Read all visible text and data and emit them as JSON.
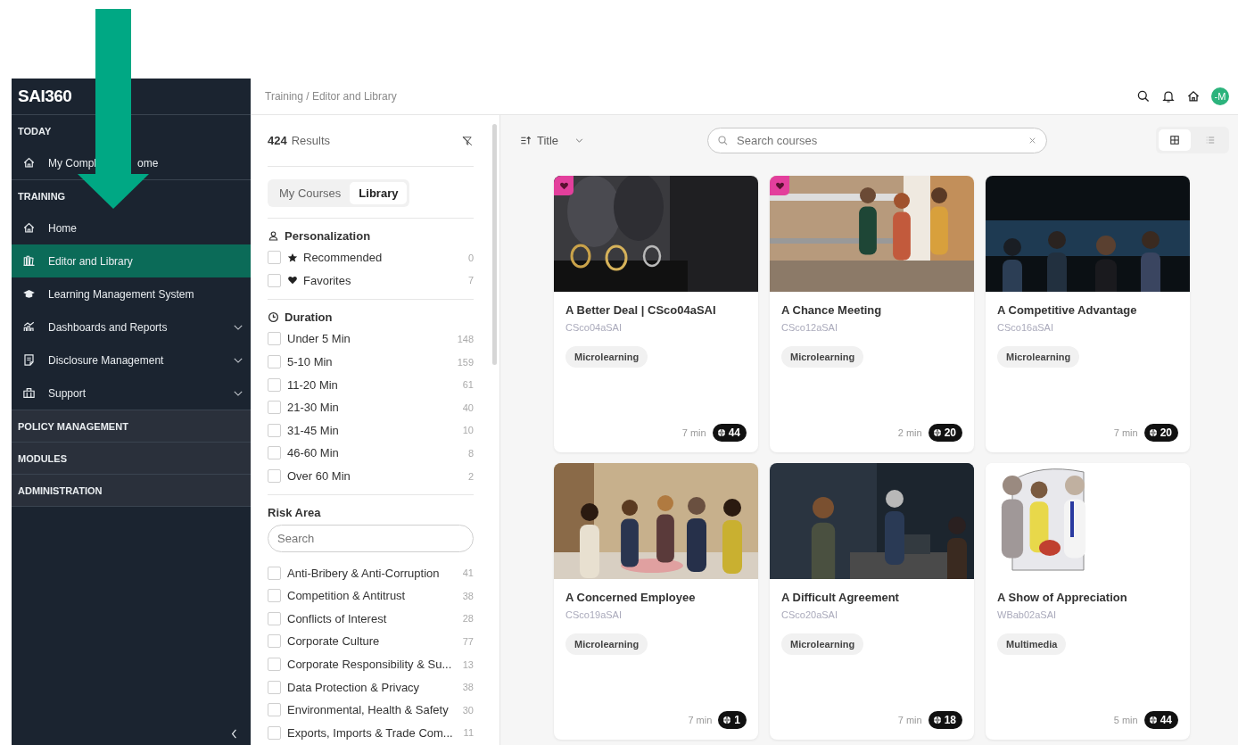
{
  "sidebar": {
    "logo": "SAI360",
    "sections": [
      {
        "title": "TODAY",
        "kind": "open",
        "items": [
          {
            "label": "My Compl",
            "label_after_cover": "ome",
            "selected": false,
            "expandable": false
          }
        ]
      },
      {
        "title": "TRAINING",
        "kind": "open",
        "items": [
          {
            "label": "Home",
            "selected": false,
            "expandable": false
          },
          {
            "label": "Editor and Library",
            "selected": true,
            "expandable": false
          },
          {
            "label": "Learning Management System",
            "selected": false,
            "expandable": false
          },
          {
            "label": "Dashboards and Reports",
            "selected": false,
            "expandable": true
          },
          {
            "label": "Disclosure Management",
            "selected": false,
            "expandable": true
          },
          {
            "label": "Support",
            "selected": false,
            "expandable": true
          }
        ]
      },
      {
        "title": "POLICY MANAGEMENT",
        "kind": "closed"
      },
      {
        "title": "MODULES",
        "kind": "closed"
      },
      {
        "title": "ADMINISTRATION",
        "kind": "closed"
      }
    ]
  },
  "header": {
    "breadcrumb": "Training / Editor and Library",
    "avatar": "-M"
  },
  "filters": {
    "results_count": "424",
    "results_label": "Results",
    "tabs": [
      {
        "label": "My Courses",
        "selected": false
      },
      {
        "label": "Library",
        "selected": true
      }
    ],
    "groups": [
      {
        "title": "Personalization",
        "kind": "icon",
        "items": [
          {
            "label": "Recommended",
            "count": "0",
            "checked": false
          },
          {
            "label": "Favorites",
            "count": "7",
            "checked": false
          }
        ]
      },
      {
        "title": "Duration",
        "kind": "icon",
        "items": [
          {
            "label": "Under 5 Min",
            "count": "148",
            "checked": false
          },
          {
            "label": "5-10 Min",
            "count": "159",
            "checked": false
          },
          {
            "label": "11-20 Min",
            "count": "61",
            "checked": false
          },
          {
            "label": "21-30 Min",
            "count": "40",
            "checked": false
          },
          {
            "label": "31-45 Min",
            "count": "10",
            "checked": false
          },
          {
            "label": "46-60 Min",
            "count": "8",
            "checked": false
          },
          {
            "label": "Over 60 Min",
            "count": "2",
            "checked": false
          }
        ]
      },
      {
        "title": "Risk Area",
        "kind": "search",
        "placeholder": "Search",
        "items": [
          {
            "label": "Anti-Bribery & Anti-Corruption",
            "count": "41",
            "checked": false
          },
          {
            "label": "Competition & Antitrust",
            "count": "38",
            "checked": false
          },
          {
            "label": "Conflicts of Interest",
            "count": "28",
            "checked": false
          },
          {
            "label": "Corporate Culture",
            "count": "77",
            "checked": false
          },
          {
            "label": "Corporate Responsibility & Su...",
            "count": "13",
            "checked": false
          },
          {
            "label": "Data Protection & Privacy",
            "count": "38",
            "checked": false
          },
          {
            "label": "Environmental, Health & Safety",
            "count": "30",
            "checked": false
          },
          {
            "label": "Exports, Imports & Trade Com...",
            "count": "11",
            "checked": false
          }
        ]
      }
    ]
  },
  "toolbar": {
    "sort": "Title",
    "search_placeholder": "Search courses",
    "views": [
      {
        "kind": "grid",
        "selected": true
      },
      {
        "kind": "list",
        "selected": false
      }
    ]
  },
  "courses": [
    {
      "title": "A Better Deal | CSco04aSAI",
      "code": "CSco04aSAI",
      "tag": "Microlearning",
      "duration": "7 min",
      "count": "44",
      "favorite": true
    },
    {
      "title": "A Chance Meeting",
      "code": "CSco12aSAI",
      "tag": "Microlearning",
      "duration": "2 min",
      "count": "20",
      "favorite": true
    },
    {
      "title": "A Competitive Advantage",
      "code": "CSco16aSAI",
      "tag": "Microlearning",
      "duration": "7 min",
      "count": "20",
      "favorite": false
    },
    {
      "title": "A Concerned Employee",
      "code": "CSco19aSAI",
      "tag": "Microlearning",
      "duration": "7 min",
      "count": "1",
      "favorite": false
    },
    {
      "title": "A Difficult Agreement",
      "code": "CSco20aSAI",
      "tag": "Microlearning",
      "duration": "7 min",
      "count": "18",
      "favorite": false
    },
    {
      "title": "A Show of Appreciation",
      "code": "WBab02aSAI",
      "tag": "Multimedia",
      "duration": "5 min",
      "count": "44",
      "favorite": false
    }
  ]
}
